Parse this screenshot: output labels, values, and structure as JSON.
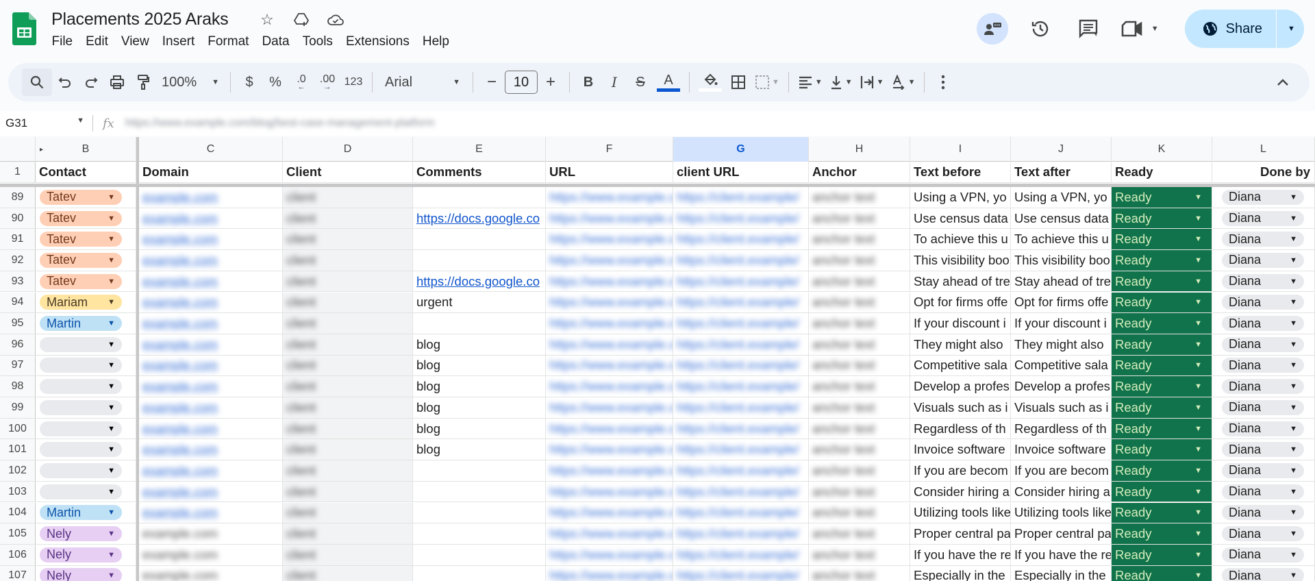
{
  "app": {
    "doc_title": "Placements 2025 Araks",
    "menu": [
      "File",
      "Edit",
      "View",
      "Insert",
      "Format",
      "Data",
      "Tools",
      "Extensions",
      "Help"
    ],
    "share_label": "Share"
  },
  "toolbar": {
    "zoom": "100%",
    "currency": "$",
    "percent": "%",
    "decrease_decimal": ".0",
    "increase_decimal": ".00",
    "number_format": "123",
    "font": "Arial",
    "font_size": "10"
  },
  "formula_bar": {
    "cell_ref": "G31",
    "content_obscured": "https://www.example.com/blog/best-case-management-platform"
  },
  "colors": {
    "ready_bg": "#11734b",
    "ready_text": "#d4edbc",
    "accent": "#0b57d0",
    "share_bg": "#c2e7ff"
  },
  "columns": [
    {
      "letter": "B",
      "header": "Contact"
    },
    {
      "letter": "C",
      "header": "Domain"
    },
    {
      "letter": "D",
      "header": "Client"
    },
    {
      "letter": "E",
      "header": "Comments"
    },
    {
      "letter": "F",
      "header": "URL"
    },
    {
      "letter": "G",
      "header": "client URL"
    },
    {
      "letter": "H",
      "header": "Anchor"
    },
    {
      "letter": "I",
      "header": "Text before"
    },
    {
      "letter": "J",
      "header": "Text after"
    },
    {
      "letter": "K",
      "header": "Ready"
    },
    {
      "letter": "L",
      "header": "Done by"
    }
  ],
  "header_row_number": "1",
  "rows": [
    {
      "n": "89",
      "contact": "Tatev",
      "contact_style": "tatev",
      "comments": "",
      "comments_link": false,
      "text_before": "Using a VPN, yo",
      "text_after": "Using a VPN, yo",
      "ready": "Ready",
      "done_by": "Diana"
    },
    {
      "n": "90",
      "contact": "Tatev",
      "contact_style": "tatev",
      "comments": "https://docs.google.co",
      "comments_link": true,
      "text_before": "Use census data",
      "text_after": "Use census data",
      "ready": "Ready",
      "done_by": "Diana"
    },
    {
      "n": "91",
      "contact": "Tatev",
      "contact_style": "tatev",
      "comments": "",
      "comments_link": false,
      "text_before": "To achieve this u",
      "text_after": "To achieve this u",
      "ready": "Ready",
      "done_by": "Diana"
    },
    {
      "n": "92",
      "contact": "Tatev",
      "contact_style": "tatev",
      "comments": "",
      "comments_link": false,
      "text_before": "This visibility boo",
      "text_after": "This visibility boo",
      "ready": "Ready",
      "done_by": "Diana"
    },
    {
      "n": "93",
      "contact": "Tatev",
      "contact_style": "tatev",
      "comments": "https://docs.google.co",
      "comments_link": true,
      "text_before": "Stay ahead of tre",
      "text_after": "Stay ahead of tre",
      "ready": "Ready",
      "done_by": "Diana"
    },
    {
      "n": "94",
      "contact": "Mariam",
      "contact_style": "mariam",
      "comments": "urgent",
      "comments_link": false,
      "text_before": "Opt for firms offe",
      "text_after": "Opt for firms offe",
      "ready": "Ready",
      "done_by": "Diana"
    },
    {
      "n": "95",
      "contact": "Martin",
      "contact_style": "martin",
      "comments": "",
      "comments_link": false,
      "text_before": "If your discount i",
      "text_after": "If your discount i",
      "ready": "Ready",
      "done_by": "Diana"
    },
    {
      "n": "96",
      "contact": "",
      "contact_style": "empty",
      "comments": "blog",
      "comments_link": false,
      "text_before": "They might also ",
      "text_after": "They might also ",
      "ready": "Ready",
      "done_by": "Diana"
    },
    {
      "n": "97",
      "contact": "",
      "contact_style": "empty",
      "comments": "blog",
      "comments_link": false,
      "text_before": "Competitive sala",
      "text_after": "Competitive sala",
      "ready": "Ready",
      "done_by": "Diana"
    },
    {
      "n": "98",
      "contact": "",
      "contact_style": "empty",
      "comments": "blog",
      "comments_link": false,
      "text_before": "Develop a profes",
      "text_after": "Develop a profes",
      "ready": "Ready",
      "done_by": "Diana"
    },
    {
      "n": "99",
      "contact": "",
      "contact_style": "empty",
      "comments": "blog",
      "comments_link": false,
      "text_before": "Visuals such as i",
      "text_after": "Visuals such as i",
      "ready": "Ready",
      "done_by": "Diana"
    },
    {
      "n": "100",
      "contact": "",
      "contact_style": "empty",
      "comments": "blog",
      "comments_link": false,
      "text_before": "Regardless of th",
      "text_after": "Regardless of th",
      "ready": "Ready",
      "done_by": "Diana"
    },
    {
      "n": "101",
      "contact": "",
      "contact_style": "empty",
      "comments": "blog",
      "comments_link": false,
      "text_before": "Invoice software ",
      "text_after": "Invoice software ",
      "ready": "Ready",
      "done_by": "Diana"
    },
    {
      "n": "102",
      "contact": "",
      "contact_style": "empty",
      "comments": "",
      "comments_link": false,
      "text_before": "If you are becom",
      "text_after": "If you are becom",
      "ready": "Ready",
      "done_by": "Diana"
    },
    {
      "n": "103",
      "contact": "",
      "contact_style": "empty",
      "comments": "",
      "comments_link": false,
      "text_before": "Consider hiring a",
      "text_after": "Consider hiring a",
      "ready": "Ready",
      "done_by": "Diana"
    },
    {
      "n": "104",
      "contact": "Martin",
      "contact_style": "martin",
      "comments": "",
      "comments_link": false,
      "text_before": "Utilizing tools like",
      "text_after": "Utilizing tools like",
      "ready": "Ready",
      "done_by": "Diana"
    },
    {
      "n": "105",
      "contact": "Nely",
      "contact_style": "nely",
      "comments": "",
      "comments_link": false,
      "text_before": "Proper central pa",
      "text_after": "Proper central pa",
      "ready": "Ready",
      "done_by": "Diana"
    },
    {
      "n": "106",
      "contact": "Nely",
      "contact_style": "nely",
      "comments": "",
      "comments_link": false,
      "text_before": "If you have the re",
      "text_after": "If you have the re",
      "ready": "Ready",
      "done_by": "Diana"
    },
    {
      "n": "107",
      "contact": "Nely",
      "contact_style": "nely",
      "comments": "",
      "comments_link": false,
      "text_before": "Especially in the",
      "text_after": "Especially in the",
      "ready": "Ready",
      "done_by": "Diana"
    }
  ],
  "obscured_placeholder": {
    "domain": "example.com",
    "client": "client",
    "url": "https://www.example.com/",
    "client_url": "https://client.example/",
    "anchor": "anchor text"
  }
}
